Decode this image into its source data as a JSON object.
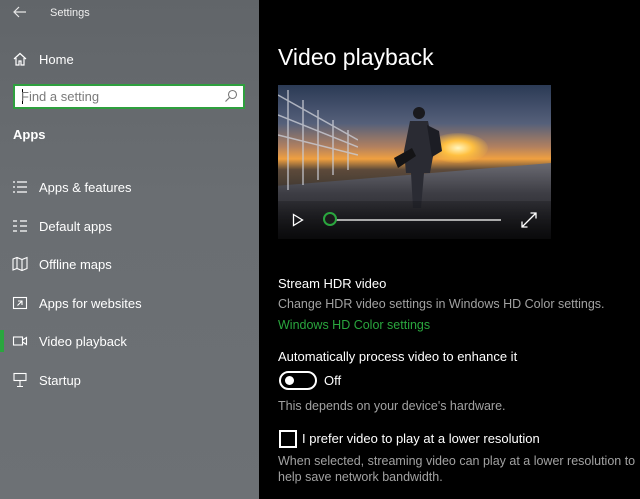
{
  "app": {
    "title": "Settings"
  },
  "sidebar": {
    "home_label": "Home",
    "search_placeholder": "Find a setting",
    "section_title": "Apps",
    "items": [
      {
        "label": "Apps & features",
        "icon": "apps-features-icon"
      },
      {
        "label": "Default apps",
        "icon": "default-apps-icon"
      },
      {
        "label": "Offline maps",
        "icon": "offline-maps-icon"
      },
      {
        "label": "Apps for websites",
        "icon": "apps-for-websites-icon"
      },
      {
        "label": "Video playback",
        "icon": "video-playback-icon",
        "active": true
      },
      {
        "label": "Startup",
        "icon": "startup-icon"
      }
    ],
    "accent_color": "#2aa63e"
  },
  "main": {
    "title": "Video playback",
    "video": {
      "progress": 0.0
    },
    "hdr": {
      "heading": "Stream HDR video",
      "description": "Change HDR video settings in Windows HD Color settings.",
      "link": "Windows HD Color settings"
    },
    "auto_process": {
      "heading": "Automatically process video to enhance it",
      "toggle_state": "Off",
      "note": "This depends on your device's hardware."
    },
    "low_resolution": {
      "checkbox_label": "I prefer video to play at a lower resolution",
      "checked": false,
      "description_line1": "When selected, streaming video can play at a lower resolution to",
      "description_line2": "help save network bandwidth."
    }
  }
}
